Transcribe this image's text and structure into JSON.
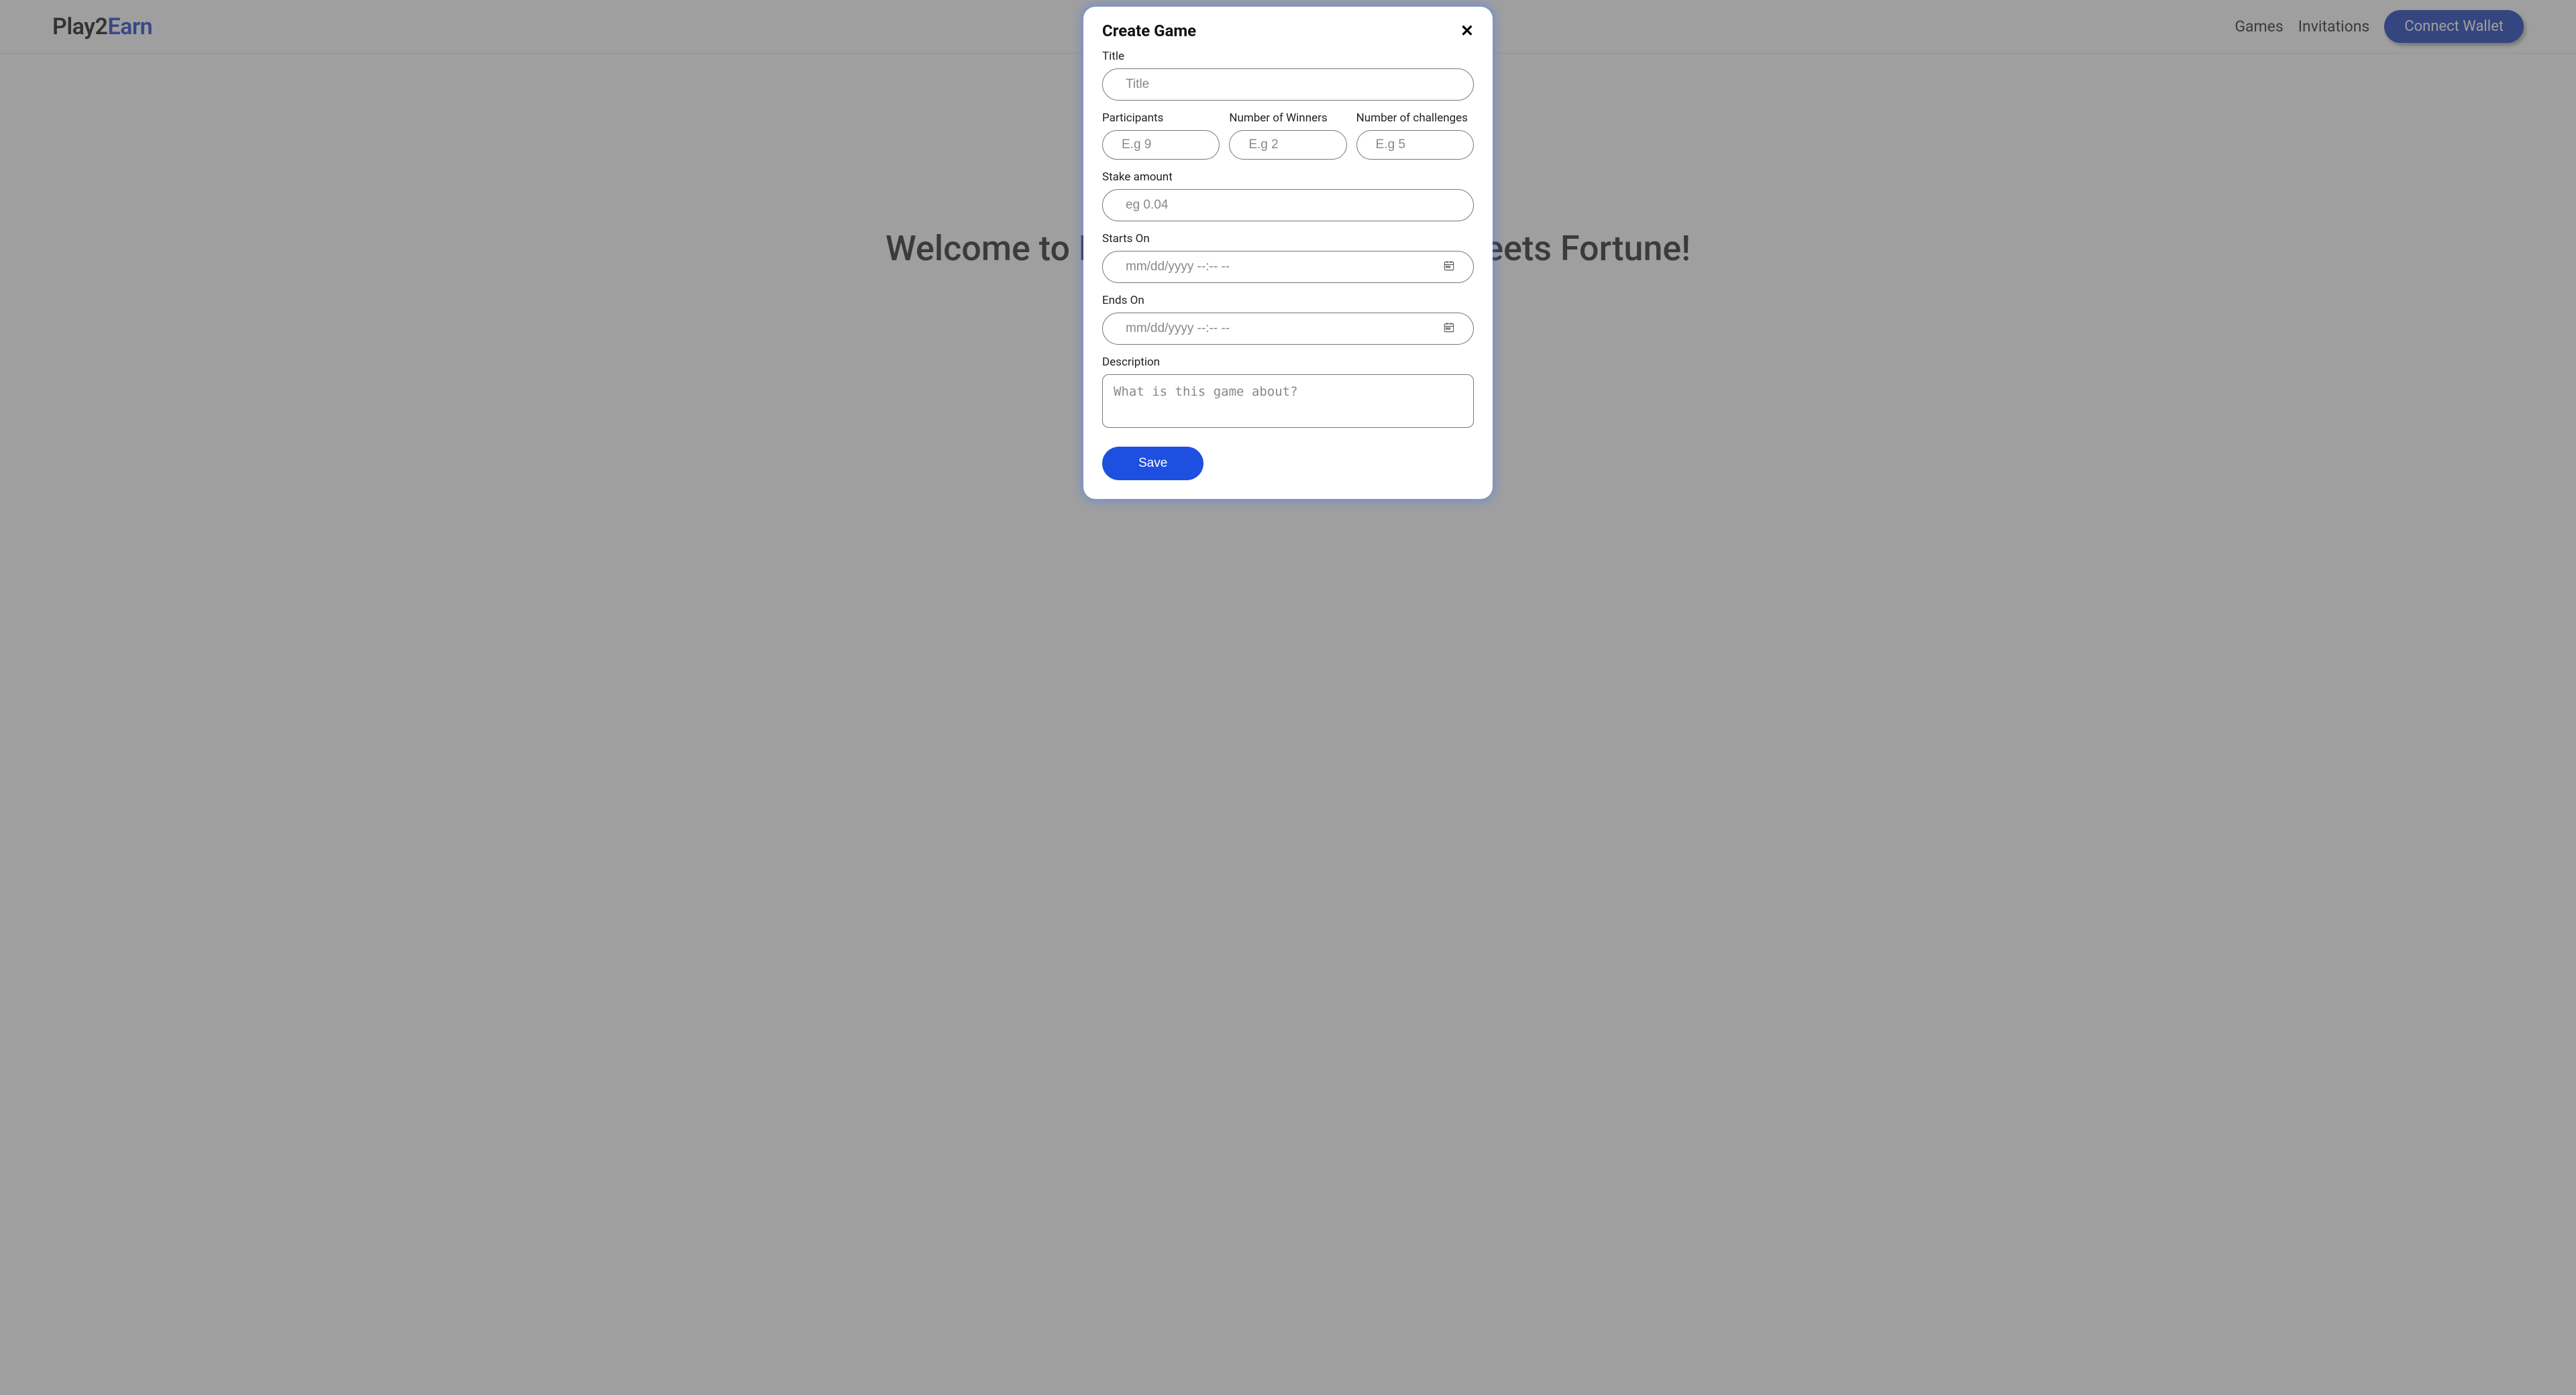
{
  "brand": {
    "part1": "Play2",
    "part2": "Earn"
  },
  "nav": {
    "games": "Games",
    "invitations": "Invitations",
    "connect": "Connect Wallet"
  },
  "hero": {
    "text": "Welcome to Play2Earn — Where Fun Meets Fortune!"
  },
  "modal": {
    "title": "Create Game",
    "fields": {
      "title_label": "Title",
      "title_placeholder": "Title",
      "participants_label": "Participants",
      "participants_placeholder": "E.g 9",
      "winners_label": "Number of Winners",
      "winners_placeholder": "E.g 2",
      "challenges_label": "Number of challenges",
      "challenges_placeholder": "E.g 5",
      "stake_label": "Stake amount",
      "stake_placeholder": "eg 0.04",
      "starts_label": "Starts On",
      "starts_placeholder": "mm/dd/yyyy --:-- --",
      "ends_label": "Ends On",
      "ends_placeholder": "mm/dd/yyyy --:-- --",
      "description_label": "Description",
      "description_placeholder": "What is this game about?"
    },
    "save": "Save"
  }
}
